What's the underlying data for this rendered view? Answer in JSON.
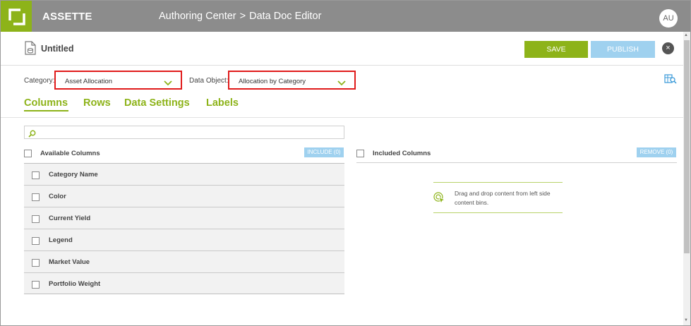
{
  "header": {
    "brand": "ASSETTE",
    "breadcrumb": [
      "Authoring Center",
      "Data Doc Editor"
    ],
    "separator": ">",
    "avatar_initials": "AU",
    "logo_icon": "bracket-logo-icon"
  },
  "document": {
    "title": "Untitled",
    "icon": "document-icon",
    "save_label": "SAVE",
    "publish_label": "PUBLISH",
    "close_symbol": "×"
  },
  "filters": {
    "category_label": "Category:",
    "category_value": "Asset Allocation",
    "data_object_label": "Data Object:",
    "data_object_value": "Allocation by Category"
  },
  "tabs": [
    {
      "label": "Columns",
      "active": true
    },
    {
      "label": "Rows",
      "active": false
    },
    {
      "label": "Data Settings",
      "active": false
    },
    {
      "label": "Labels",
      "active": false
    }
  ],
  "search": {
    "placeholder": "",
    "value": ""
  },
  "available": {
    "title": "Available Columns",
    "include_label": "INCLUDE (0)",
    "items": [
      "Category Name",
      "Color",
      "Current Yield",
      "Legend",
      "Market Value",
      "Portfolio Weight"
    ]
  },
  "included": {
    "title": "Included Columns",
    "remove_label": "REMOVE (0)",
    "empty_message": "Drag and drop content from left side content bins."
  },
  "colors": {
    "accent_green": "#8db319",
    "topbar_gray": "#8c8c8c",
    "light_blue": "#9fd1ef",
    "highlight_red": "#e01b1b"
  }
}
